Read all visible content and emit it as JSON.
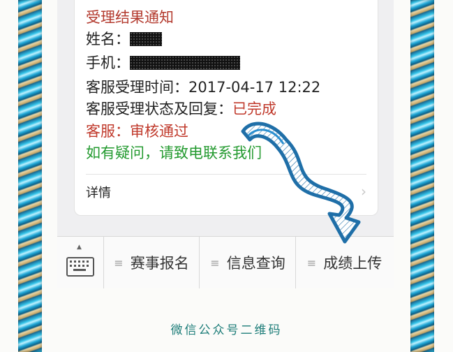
{
  "card": {
    "title": "受理结果通知",
    "name_label": "姓名：",
    "phone_label": "手机：",
    "time_label": "客服受理时间：",
    "time_value": "2017-04-17 12:22",
    "status_label": "客服受理状态及回复：",
    "status_value": "已完成",
    "cs_line": "客服：审核通过",
    "help_line": "如有疑问，请致电联系我们",
    "detail_label": "详情",
    "detail_arrow": "›"
  },
  "menu": {
    "items": [
      {
        "label": "赛事报名",
        "icon": "≡"
      },
      {
        "label": "信息查询",
        "icon": "≡"
      },
      {
        "label": "成绩上传",
        "icon": "≡"
      }
    ],
    "keyboard_chevron": "▲"
  },
  "caption": "微信公众号二维码",
  "colors": {
    "title_red": "#b33a2e",
    "help_green": "#239a2f",
    "arrow_blue": "#1f6fa8",
    "caption_teal": "#1b7c78"
  }
}
